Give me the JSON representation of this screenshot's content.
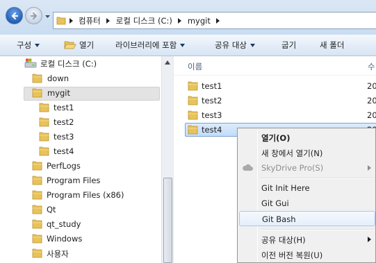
{
  "address_bar": {
    "breadcrumbs": [
      "컴퓨터",
      "로컬 디스크 (C:)",
      "mygit"
    ]
  },
  "toolbar": {
    "organize": "구성",
    "open": "열기",
    "include_in_library": "라이브러리에 포함",
    "share_with": "공유 대상",
    "burn": "굽기",
    "new_folder": "새 폴더"
  },
  "tree": {
    "items": [
      {
        "label": "로컬 디스크 (C:)",
        "icon": "drive-icon"
      },
      {
        "label": "down"
      },
      {
        "label": "mygit",
        "selected": true
      },
      {
        "label": "test1"
      },
      {
        "label": "test2"
      },
      {
        "label": "test3"
      },
      {
        "label": "test4"
      },
      {
        "label": "PerfLogs"
      },
      {
        "label": "Program Files"
      },
      {
        "label": "Program Files (x86)"
      },
      {
        "label": "Qt"
      },
      {
        "label": "qt_study"
      },
      {
        "label": "Windows"
      },
      {
        "label": "사용자"
      }
    ]
  },
  "files": {
    "column_name": "이름",
    "column_date": "수",
    "rows": [
      {
        "name": "test1",
        "date": "20"
      },
      {
        "name": "test2",
        "date": "20"
      },
      {
        "name": "test3",
        "date": "20"
      },
      {
        "name": "test4",
        "date": "20",
        "selected": true
      }
    ]
  },
  "context_menu": {
    "open": "열기(O)",
    "open_new_window": "새 창에서 열기(N)",
    "skydrive_pro": "SkyDrive Pro(S)",
    "git_init_here": "Git Init Here",
    "git_gui": "Git Gui",
    "git_bash": "Git Bash",
    "share_with": "공유 대상(H)",
    "restore_previous": "이전 버전 복원(U)"
  },
  "colors": {
    "accent": "#3a7bd5",
    "selection": "#cce4fb",
    "folder": "#e8c25a"
  }
}
